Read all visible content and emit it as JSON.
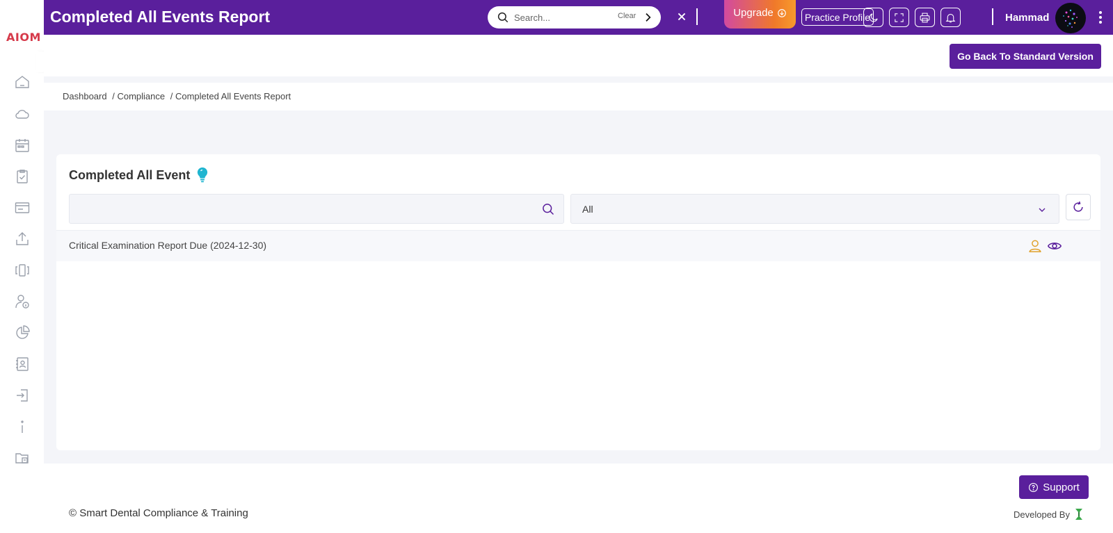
{
  "app": {
    "logo_text": "AIOM"
  },
  "header": {
    "title": "Completed All Events Report",
    "search_placeholder": "Search...",
    "search_clear": "Clear",
    "upgrade_label": "Upgrade",
    "practice_profile_label": "Practice Profile",
    "user_name": "Hammad"
  },
  "subheader": {
    "back_button_label": "Go Back To Standard Version"
  },
  "breadcrumb": {
    "items": [
      "Dashboard",
      "/ Compliance",
      "/ Completed All Events Report"
    ]
  },
  "card": {
    "title": "Completed All Event",
    "search_value": "",
    "filter_selected": "All",
    "rows": [
      {
        "text": "Critical Examination Report Due (2024-12-30)"
      }
    ]
  },
  "footer": {
    "support_label": "Support",
    "copyright": "© Smart Dental Compliance & Training",
    "developed_by": "Developed By"
  },
  "colors": {
    "primary": "#5a1f9c",
    "upgrade_gradient_start": "#d24aa0",
    "upgrade_gradient_end": "#f89b2c",
    "bulb": "#1fb5d0",
    "assign_icon": "#e0a12a"
  },
  "icons": {
    "sidebar": [
      "home-icon",
      "cloud-icon",
      "calendar-icon",
      "checklist-icon",
      "card-icon",
      "upload-icon",
      "carousel-icon",
      "user-info-icon",
      "pie-chart-icon",
      "contacts-icon",
      "login-icon",
      "info-icon",
      "archive-folder-icon"
    ]
  }
}
